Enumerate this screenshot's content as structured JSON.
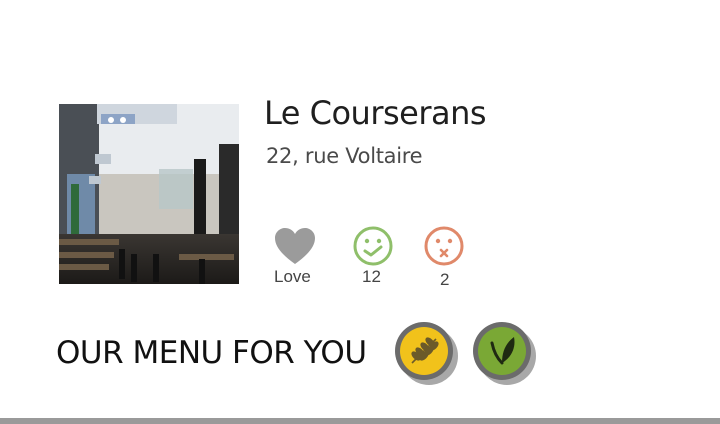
{
  "restaurant": {
    "name": "Le Courserans",
    "address": "22, rue Voltaire"
  },
  "actions": {
    "love": {
      "label": "Love",
      "icon": "heart-icon",
      "color": "#9b9b9b"
    },
    "good": {
      "count": "12",
      "icon": "smiley-happy-icon",
      "color": "#8fbf6a"
    },
    "bad": {
      "count": "2",
      "icon": "smiley-sad-icon",
      "color": "#e0896a"
    }
  },
  "menu": {
    "heading": "OUR MENU FOR YOU",
    "badges": [
      {
        "icon": "wheat-icon",
        "color": "#f1c21b"
      },
      {
        "icon": "leaf-icon",
        "color": "#7aa835"
      }
    ]
  },
  "colors": {
    "badge_ring": "#6b6b6b",
    "bottom_bar": "#9a9a9a"
  }
}
